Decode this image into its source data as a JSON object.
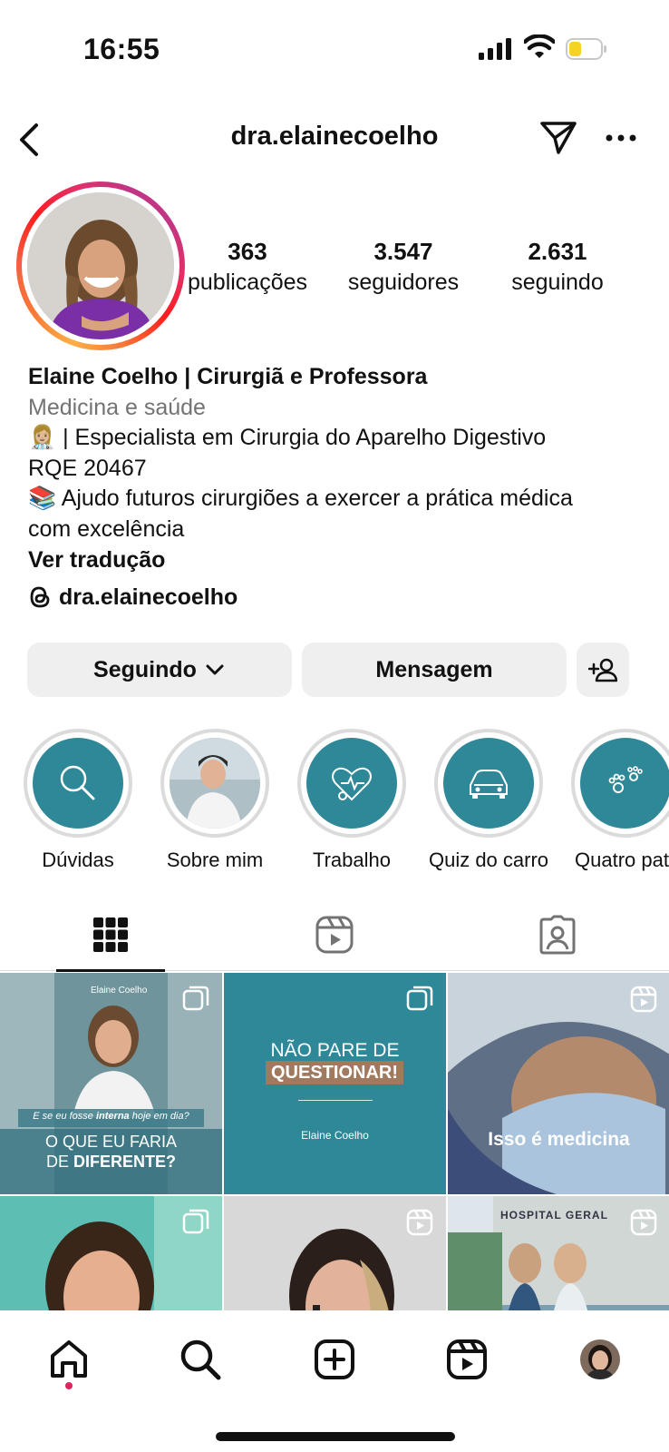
{
  "status_bar": {
    "time": "16:55",
    "battery_level": 0.2
  },
  "header": {
    "username": "dra.elainecoelho"
  },
  "stats": {
    "posts": {
      "value": "363",
      "label": "publicações"
    },
    "followers": {
      "value": "3.547",
      "label": "seguidores"
    },
    "following": {
      "value": "2.631",
      "label": "seguindo"
    }
  },
  "bio": {
    "name": "Elaine Coelho | Cirurgiã e Professora",
    "category": "Medicina e saúde",
    "line1": "👩🏼‍⚕️ | Especialista em Cirurgia do Aparelho Digestivo",
    "line2": "RQE 20467",
    "line3": "📚  Ajudo futuros cirurgiões a exercer a prática médica",
    "line4": "com excelência",
    "translate": "Ver tradução",
    "threads_handle": "dra.elainecoelho"
  },
  "buttons": {
    "following": "Seguindo",
    "message": "Mensagem"
  },
  "highlights": [
    {
      "label": "Dúvidas",
      "icon": "magnifier-icon"
    },
    {
      "label": "Sobre mim",
      "icon": "photo"
    },
    {
      "label": "Trabalho",
      "icon": "stethoscope-icon"
    },
    {
      "label": "Quiz do carro",
      "icon": "car-icon"
    },
    {
      "label": "Quatro patas",
      "icon": "paw-icon"
    }
  ],
  "tabs": [
    "grid-tab",
    "reels-tab",
    "tagged-tab"
  ],
  "posts": {
    "p1": {
      "brand": "Elaine Coelho",
      "question_pre": "E se eu fosse ",
      "question_em": "interna",
      "question_post": " hoje em dia?",
      "title1": "O QUE EU FARIA",
      "title2a": "DE ",
      "title2b": "DIFERENTE?"
    },
    "p2": {
      "title1": "NÃO PARE DE",
      "title2": "QUESTIONAR!",
      "brand": "Elaine Coelho"
    },
    "p3": {
      "caption": "Isso é medicina"
    },
    "p6": {
      "sign": "HOSPITAL GERAL"
    }
  },
  "colors": {
    "teal": "#2e8897",
    "highlight_ring": "#dbdbdb",
    "button_bg": "#efefef",
    "notification_dot": "#e0245e"
  }
}
